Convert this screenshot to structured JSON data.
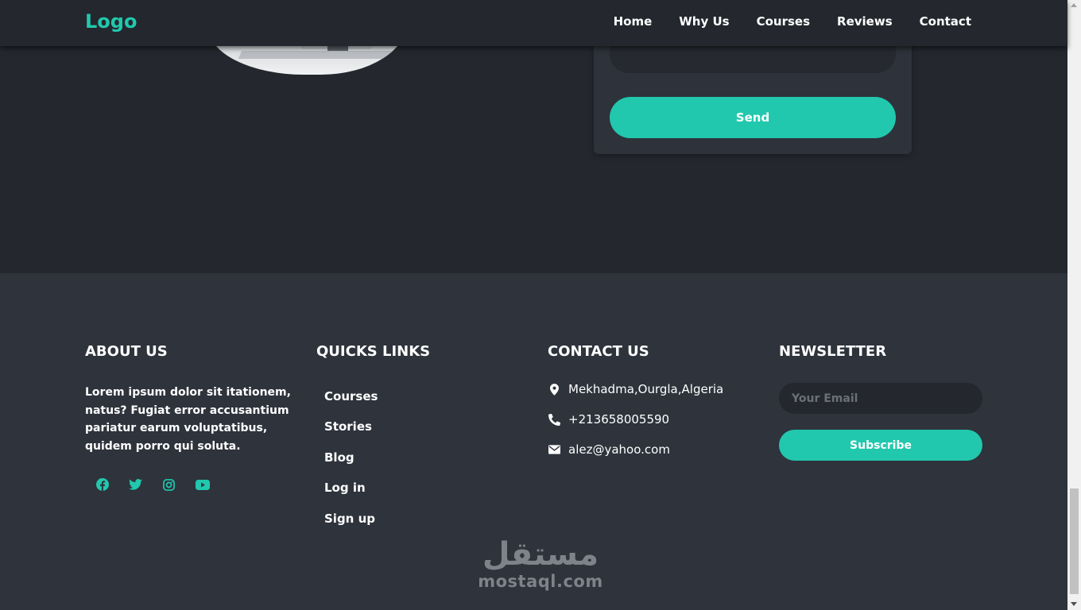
{
  "navbar": {
    "logo": "Logo",
    "links": [
      "Home",
      "Why Us",
      "Courses",
      "Reviews",
      "Contact"
    ]
  },
  "contact_form": {
    "send_label": "Send"
  },
  "footer": {
    "about": {
      "title": "ABOUT US",
      "text": "Lorem ipsum dolor sit itationem, natus? Fugiat error accusantium pariatur earum voluptatibus, quidem porro qui soluta.",
      "socials": [
        "facebook-icon",
        "twitter-icon",
        "instagram-icon",
        "youtube-icon"
      ]
    },
    "quick_links": {
      "title": "QUICKS LINKS",
      "items": [
        "Courses",
        "Stories",
        "Blog",
        "Log in",
        "Sign up"
      ]
    },
    "contact": {
      "title": "CONTACT US",
      "address": "Mekhadma,Ourgla,Algeria",
      "phone": "+213658005590",
      "email": "alez@yahoo.com"
    },
    "newsletter": {
      "title": "NEWSLETTER",
      "placeholder": "Your Email",
      "subscribe_label": "Subscribe"
    }
  },
  "watermark": {
    "arabic": "مستقل",
    "latin": "mostaql.com"
  },
  "colors": {
    "accent": "#21c8ad",
    "background_dark": "#24282e",
    "footer_bg": "#2e333c"
  }
}
